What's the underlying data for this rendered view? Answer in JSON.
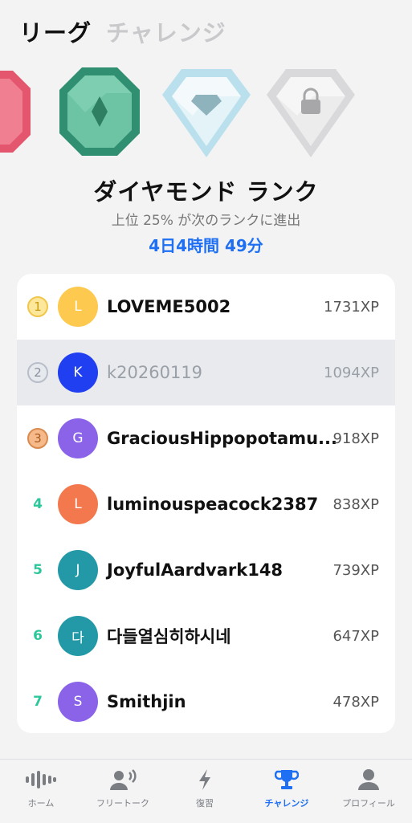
{
  "header": {
    "tabs": [
      {
        "label": "リーグ"
      },
      {
        "label": "チャレンジ"
      }
    ]
  },
  "rank": {
    "title": "ダイヤモンド ランク",
    "subtitle": "上位 25% が次のランクに進出",
    "timer": "4日4時間 49分"
  },
  "leaderboard": [
    {
      "rank": "1",
      "initial": "L",
      "name": "LOVEME5002",
      "xp": "1731XP",
      "avatar_color": "#fdc94e"
    },
    {
      "rank": "2",
      "initial": "K",
      "name": "k20260119",
      "xp": "1094XP",
      "avatar_color": "#1f3ff0"
    },
    {
      "rank": "3",
      "initial": "G",
      "name": "GraciousHippopotamu...",
      "xp": "918XP",
      "avatar_color": "#8a63e8"
    },
    {
      "rank": "4",
      "initial": "L",
      "name": "luminouspeacock2387",
      "xp": "838XP",
      "avatar_color": "#f4784e"
    },
    {
      "rank": "5",
      "initial": "J",
      "name": "JoyfulAardvark148",
      "xp": "739XP",
      "avatar_color": "#2399a8"
    },
    {
      "rank": "6",
      "initial": "다",
      "name": "다들열심히하시네",
      "xp": "647XP",
      "avatar_color": "#2399a8"
    },
    {
      "rank": "7",
      "initial": "S",
      "name": "Smithjin",
      "xp": "478XP",
      "avatar_color": "#8a63e8"
    }
  ],
  "nav": [
    {
      "label": "ホーム",
      "icon": "waveform-icon"
    },
    {
      "label": "フリートーク",
      "icon": "speaking-person-icon"
    },
    {
      "label": "復習",
      "icon": "lightning-icon"
    },
    {
      "label": "チャレンジ",
      "icon": "trophy-icon"
    },
    {
      "label": "プロフィール",
      "icon": "person-icon"
    }
  ],
  "colors": {
    "accent": "#1e6ff1",
    "rank_number": "#2bc79a"
  }
}
